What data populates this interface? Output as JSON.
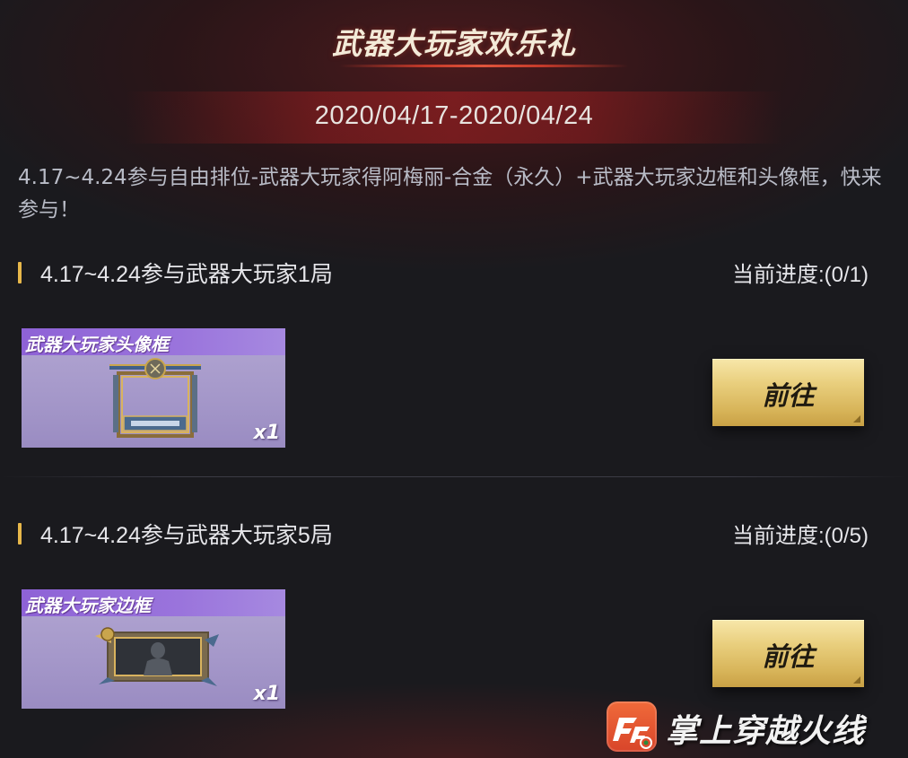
{
  "header": {
    "title": "武器大玩家欢乐礼",
    "date_range": "2020/04/17-2020/04/24"
  },
  "description": "4.17~4.24参与自由排位-武器大玩家得阿梅丽-合金（永久）+武器大玩家边框和头像框，快来参与！",
  "tasks": [
    {
      "title": "4.17~4.24参与武器大玩家1局",
      "progress": "当前进度:(0/1)",
      "reward": {
        "name": "武器大玩家头像框",
        "count": "x1",
        "icon": "avatar-frame-icon"
      },
      "button_label": "前往"
    },
    {
      "title": "4.17~4.24参与武器大玩家5局",
      "progress": "当前进度:(0/5)",
      "reward": {
        "name": "武器大玩家边框",
        "count": "x1",
        "icon": "border-frame-icon"
      },
      "button_label": "前往"
    }
  ],
  "watermark": {
    "text": "掌上穿越火线",
    "logo_icon": "cf-logo-icon"
  },
  "colors": {
    "accent_gold": "#e7b74a",
    "button_gold": "#e9cf7e",
    "reward_purple": "#9a74dc",
    "title_red": "#c43a2a"
  }
}
